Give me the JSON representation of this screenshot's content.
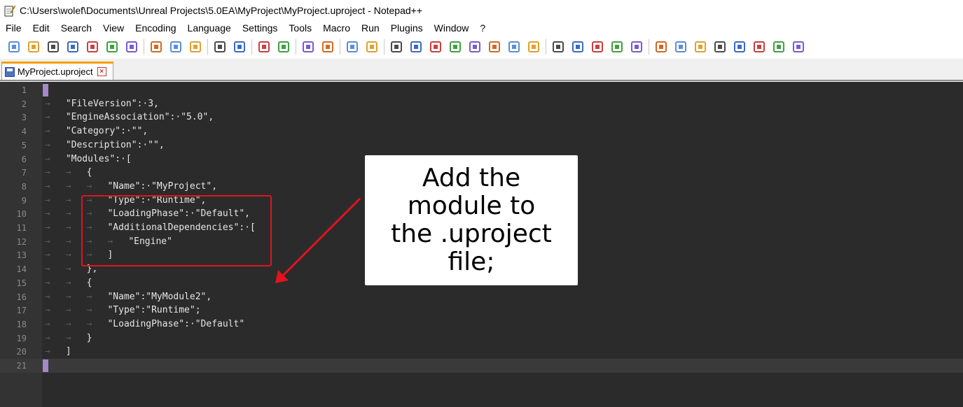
{
  "window": {
    "title": "C:\\Users\\wolef\\Documents\\Unreal Projects\\5.0EA\\MyProject\\MyProject.uproject - Notepad++"
  },
  "menu": [
    "File",
    "Edit",
    "Search",
    "View",
    "Encoding",
    "Language",
    "Settings",
    "Tools",
    "Macro",
    "Run",
    "Plugins",
    "Window",
    "?"
  ],
  "tab": {
    "label": "MyProject.uproject",
    "close": "×"
  },
  "editor": {
    "lines": [
      {
        "n": "1",
        "indent": "",
        "text": ""
      },
      {
        "n": "2",
        "indent": "→",
        "text": "\"FileVersion\":·3,"
      },
      {
        "n": "3",
        "indent": "→",
        "text": "\"EngineAssociation\":·\"5.0\","
      },
      {
        "n": "4",
        "indent": "→",
        "text": "\"Category\":·\"\","
      },
      {
        "n": "5",
        "indent": "→",
        "text": "\"Description\":·\"\","
      },
      {
        "n": "6",
        "indent": "→",
        "text": "\"Modules\":·["
      },
      {
        "n": "7",
        "indent": "→→",
        "text": "{"
      },
      {
        "n": "8",
        "indent": "→→→",
        "text": "\"Name\":·\"MyProject\","
      },
      {
        "n": "9",
        "indent": "→→→",
        "text": "\"Type\":·\"Runtime\","
      },
      {
        "n": "10",
        "indent": "→→→",
        "text": "\"LoadingPhase\":·\"Default\","
      },
      {
        "n": "11",
        "indent": "→→→",
        "text": "\"AdditionalDependencies\":·["
      },
      {
        "n": "12",
        "indent": "→→→→",
        "text": "\"Engine\""
      },
      {
        "n": "13",
        "indent": "→→→",
        "text": "]"
      },
      {
        "n": "14",
        "indent": "→→",
        "text": "},"
      },
      {
        "n": "15",
        "indent": "→→",
        "text": "{"
      },
      {
        "n": "16",
        "indent": "→→→",
        "text": "\"Name\":\"MyModule2\","
      },
      {
        "n": "17",
        "indent": "→→→",
        "text": "\"Type\":\"Runtime\";"
      },
      {
        "n": "18",
        "indent": "→→→",
        "text": "\"LoadingPhase\":·\"Default\""
      },
      {
        "n": "19",
        "indent": "→→",
        "text": "}"
      },
      {
        "n": "20",
        "indent": "→",
        "text": "]"
      },
      {
        "n": "21",
        "indent": "",
        "text": ""
      }
    ]
  },
  "callout": {
    "text": "Add the\nmodule to\nthe .uproject\nfile;"
  },
  "colors": {
    "editor_bg": "#2b2b2b",
    "highlight": "#e0141e",
    "caret": "#a488c8",
    "tab_accent": "#f5a000"
  },
  "toolbar_icons": [
    "new-icon",
    "open-icon",
    "save-icon",
    "save-all-icon",
    "close-icon",
    "close-all-icon",
    "print-icon",
    "cut-icon",
    "copy-icon",
    "paste-icon",
    "undo-icon",
    "redo-icon",
    "find-icon",
    "replace-icon",
    "zoom-in-icon",
    "zoom-out-icon",
    "sync-v-icon",
    "sync-h-icon",
    "wrap-icon",
    "show-all-chars-icon",
    "indent-guide-icon",
    "udl-icon",
    "doc-map-icon",
    "func-list-icon",
    "folder-workspace-icon",
    "monitor-icon",
    "record-icon",
    "stop-icon",
    "play-icon",
    "play-multi-icon",
    "save-macro-icon",
    "spell-icon",
    "compare-icon",
    "compare-2-icon",
    "fold-icon",
    "up-icon",
    "down-icon",
    "unfold-icon",
    "panel-icon"
  ]
}
